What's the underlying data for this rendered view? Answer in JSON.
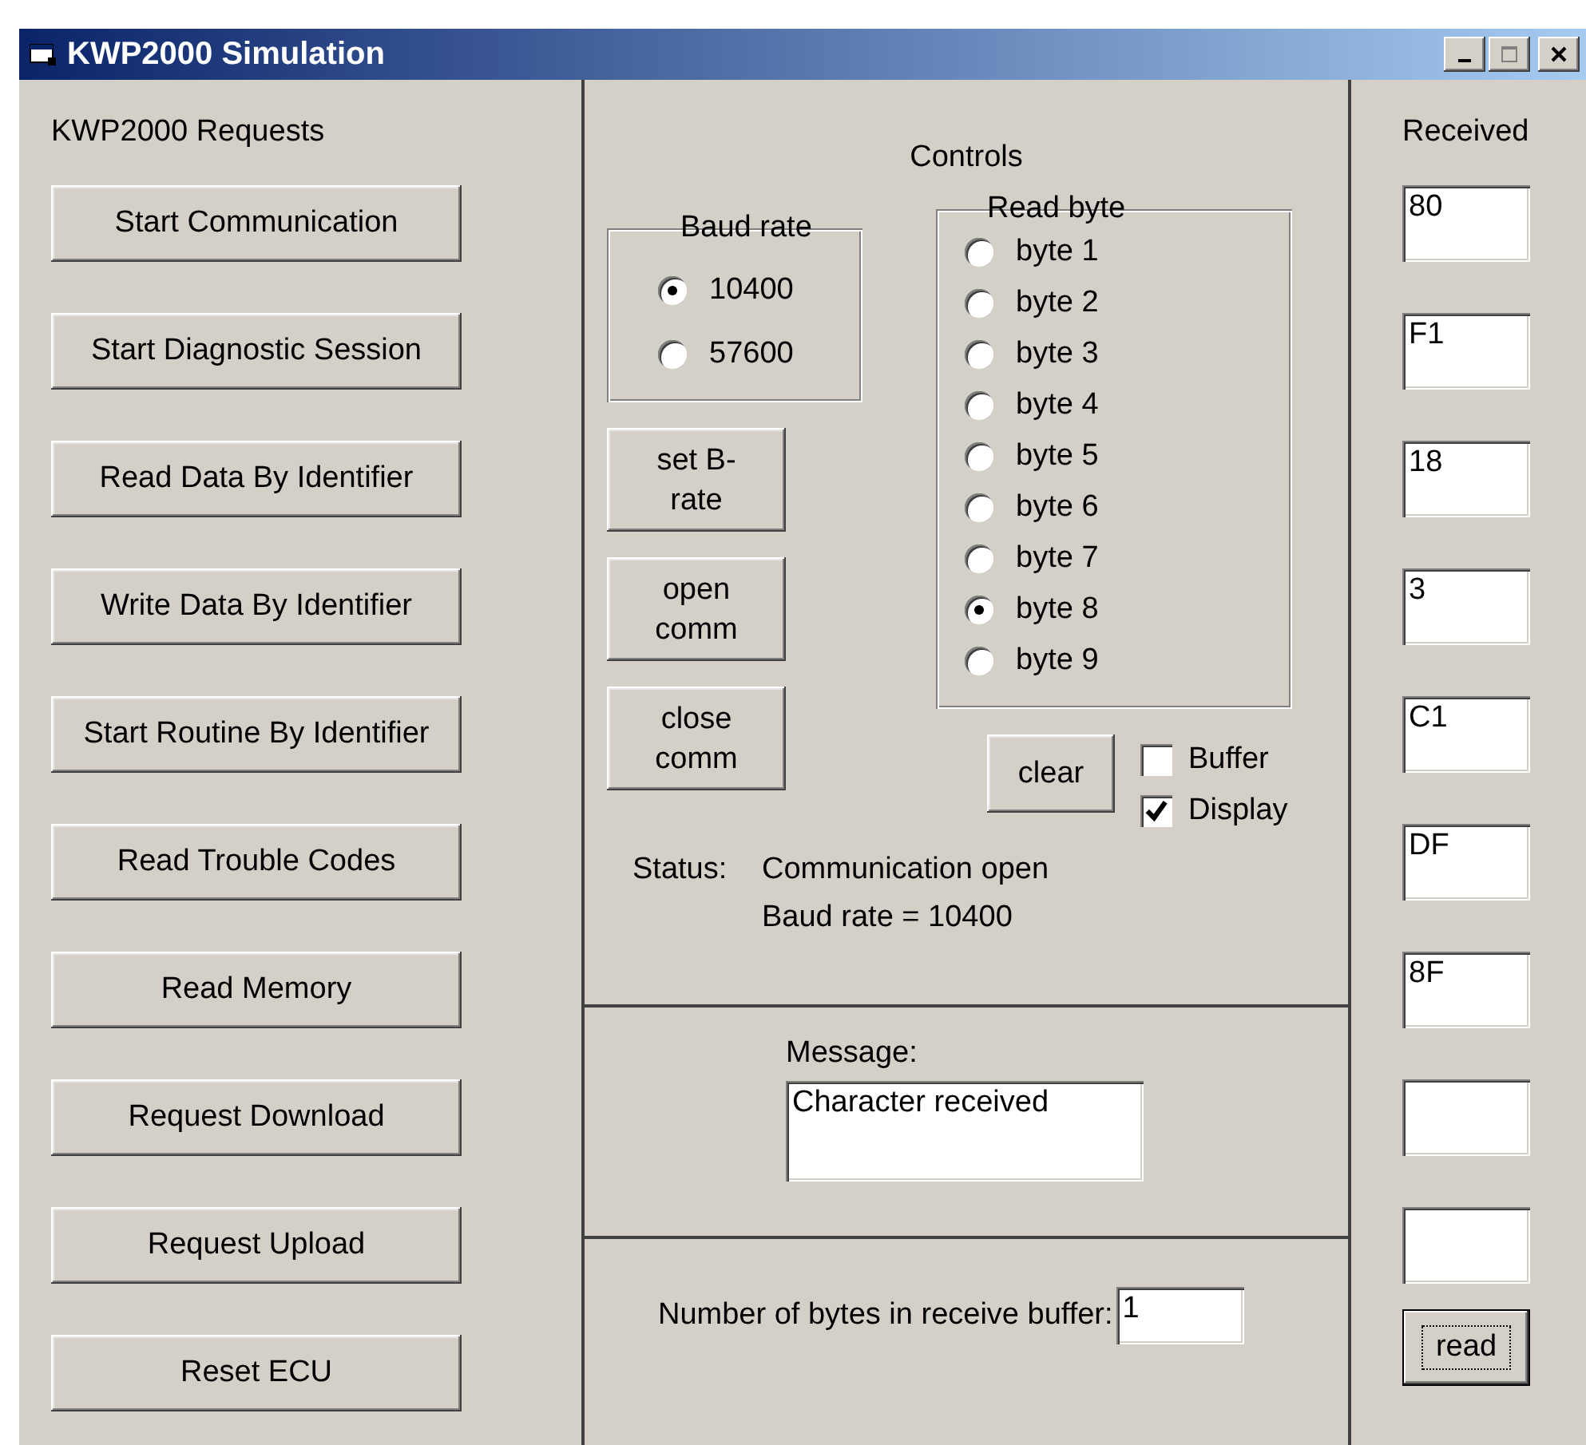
{
  "window": {
    "title": "KWP2000 Simulation"
  },
  "requests": {
    "heading": "KWP2000 Requests",
    "buttons": [
      "Start Communication",
      "Start Diagnostic Session",
      "Read Data By Identifier",
      "Write Data By Identifier",
      "Start Routine By Identifier",
      "Read Trouble Codes",
      "Read Memory",
      "Request Download",
      "Request Upload",
      "Reset ECU"
    ]
  },
  "controls": {
    "heading": "Controls",
    "baud_rate": {
      "label": "Baud rate",
      "options": [
        {
          "label": "10400",
          "selected": true
        },
        {
          "label": "57600",
          "selected": false
        }
      ]
    },
    "buttons": [
      "set B-rate",
      "open comm",
      "close comm"
    ],
    "read_byte": {
      "label": "Read byte",
      "options": [
        {
          "label": "byte 1",
          "selected": false
        },
        {
          "label": "byte 2",
          "selected": false
        },
        {
          "label": "byte 3",
          "selected": false
        },
        {
          "label": "byte 4",
          "selected": false
        },
        {
          "label": "byte 5",
          "selected": false
        },
        {
          "label": "byte 6",
          "selected": false
        },
        {
          "label": "byte 7",
          "selected": false
        },
        {
          "label": "byte 8",
          "selected": true
        },
        {
          "label": "byte 9",
          "selected": false
        }
      ]
    },
    "clear_button": "clear",
    "checkboxes": [
      {
        "label": "Buffer",
        "checked": false
      },
      {
        "label": "Display",
        "checked": true
      }
    ],
    "status": {
      "label": "Status:",
      "lines": [
        "Communication open",
        "Baud rate = 10400"
      ]
    }
  },
  "message": {
    "label": "Message:",
    "value": "Character received"
  },
  "receive_buffer": {
    "label": "Number of bytes in receive buffer:",
    "value": "1"
  },
  "received": {
    "heading": "Received",
    "fields": [
      {
        "kind": "text",
        "value": "80"
      },
      {
        "kind": "text",
        "value": "F1"
      },
      {
        "kind": "text",
        "value": "18"
      },
      {
        "kind": "text",
        "value": "3"
      },
      {
        "kind": "text",
        "value": "C1"
      },
      {
        "kind": "text",
        "value": "DF"
      },
      {
        "kind": "text",
        "value": "8F"
      },
      {
        "kind": "empty"
      },
      {
        "kind": "empty"
      }
    ],
    "read_button": "read"
  }
}
